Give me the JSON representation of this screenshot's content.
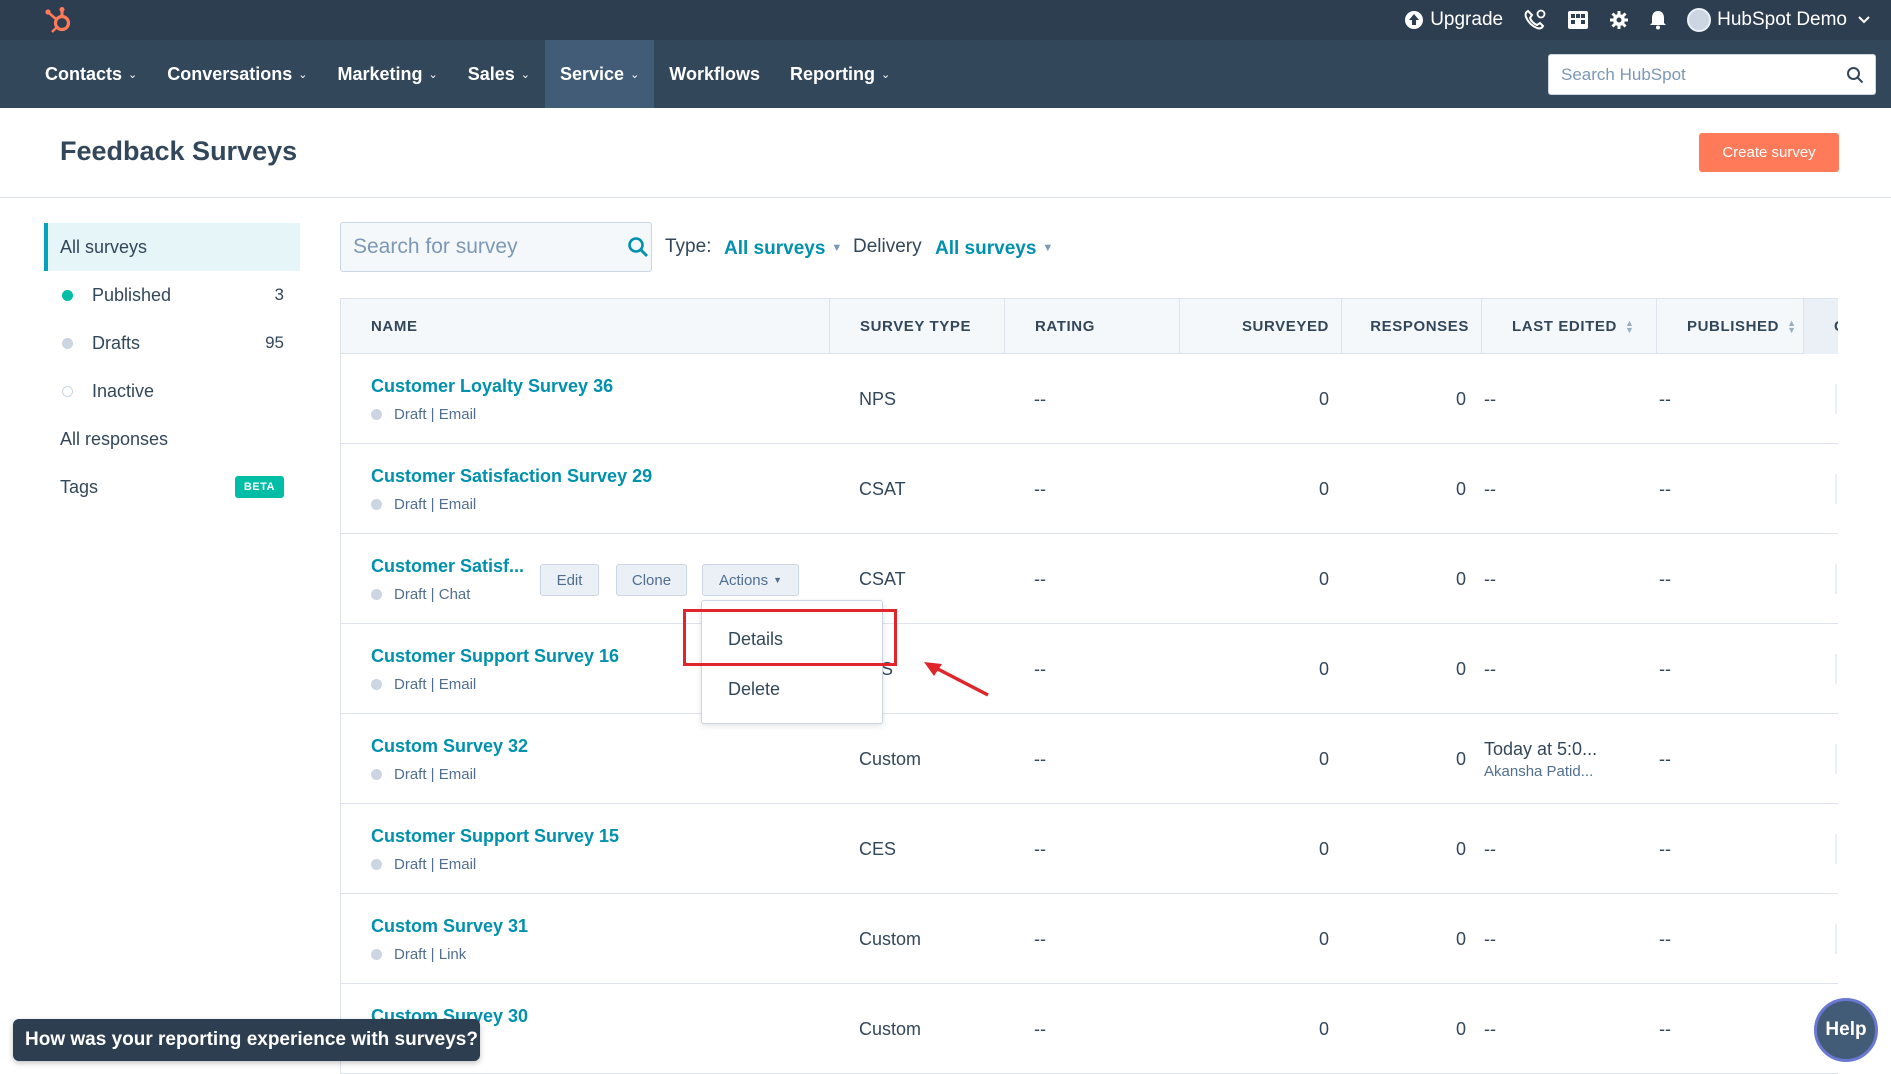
{
  "topbar": {
    "upgrade_label": "Upgrade",
    "account_name": "HubSpot Demo"
  },
  "nav": {
    "items": [
      {
        "label": "Contacts",
        "dropdown": true
      },
      {
        "label": "Conversations",
        "dropdown": true
      },
      {
        "label": "Marketing",
        "dropdown": true
      },
      {
        "label": "Sales",
        "dropdown": true
      },
      {
        "label": "Service",
        "dropdown": true,
        "active": true
      },
      {
        "label": "Workflows",
        "dropdown": false
      },
      {
        "label": "Reporting",
        "dropdown": true
      }
    ],
    "search_placeholder": "Search HubSpot"
  },
  "header": {
    "title": "Feedback Surveys",
    "create_button": "Create survey"
  },
  "sidebar": {
    "items": [
      {
        "label": "All surveys",
        "active": true
      },
      {
        "label": "Published",
        "count": "3",
        "dot_color": "#00bda5"
      },
      {
        "label": "Drafts",
        "count": "95",
        "dot_color": "#cbd6e2"
      },
      {
        "label": "Inactive",
        "dot_color": "hollow"
      },
      {
        "label": "All responses"
      },
      {
        "label": "Tags",
        "badge": "BETA"
      }
    ]
  },
  "filters": {
    "search_placeholder": "Search for survey",
    "type_label": "Type:",
    "type_value": "All surveys",
    "delivery_label": "Delivery",
    "delivery_value": "All surveys"
  },
  "table": {
    "columns": [
      "NAME",
      "SURVEY TYPE",
      "RATING",
      "SURVEYED",
      "RESPONSES",
      "LAST EDITED",
      "PUBLISHED",
      "C"
    ],
    "rows": [
      {
        "name": "Customer Loyalty Survey 36",
        "status": "Draft | Email",
        "type": "NPS",
        "rating": "--",
        "surveyed": "0",
        "responses": "0",
        "last_edited": "--",
        "last_edited_by": "",
        "published": "--"
      },
      {
        "name": "Customer Satisfaction Survey 29",
        "status": "Draft | Email",
        "type": "CSAT",
        "rating": "--",
        "surveyed": "0",
        "responses": "0",
        "last_edited": "--",
        "last_edited_by": "",
        "published": "--"
      },
      {
        "name": "Customer Satisf...",
        "status": "Draft | Chat",
        "type": "CSAT",
        "rating": "--",
        "surveyed": "0",
        "responses": "0",
        "last_edited": "--",
        "last_edited_by": "",
        "published": "--"
      },
      {
        "name": "Customer Support Survey 16",
        "status": "Draft | Email",
        "type": "S",
        "rating": "--",
        "surveyed": "0",
        "responses": "0",
        "last_edited": "--",
        "last_edited_by": "",
        "published": "--"
      },
      {
        "name": "Custom Survey 32",
        "status": "Draft | Email",
        "type": "Custom",
        "rating": "--",
        "surveyed": "0",
        "responses": "0",
        "last_edited": "Today at 5:0...",
        "last_edited_by": "Akansha Patid...",
        "published": "--"
      },
      {
        "name": "Customer Support Survey 15",
        "status": "Draft | Email",
        "type": "CES",
        "rating": "--",
        "surveyed": "0",
        "responses": "0",
        "last_edited": "--",
        "last_edited_by": "",
        "published": "--"
      },
      {
        "name": "Custom Survey 31",
        "status": "Draft | Link",
        "type": "Custom",
        "rating": "--",
        "surveyed": "0",
        "responses": "0",
        "last_edited": "--",
        "last_edited_by": "",
        "published": "--"
      },
      {
        "name": "Custom Survey 30",
        "status": "",
        "type": "Custom",
        "rating": "--",
        "surveyed": "0",
        "responses": "0",
        "last_edited": "--",
        "last_edited_by": "",
        "published": "--"
      }
    ],
    "row_actions": {
      "edit": "Edit",
      "clone": "Clone",
      "actions": "Actions"
    }
  },
  "actions_menu": {
    "items": [
      "Details",
      "Delete"
    ]
  },
  "feedback_banner": "How was your reporting experience with surveys?",
  "help_button": "Help",
  "colors": {
    "topbar": "#2d3e50",
    "navbar": "#33475b",
    "accent_link": "#0091ae",
    "primary_button": "#ff7a59",
    "annotation_red": "#e0252b"
  }
}
